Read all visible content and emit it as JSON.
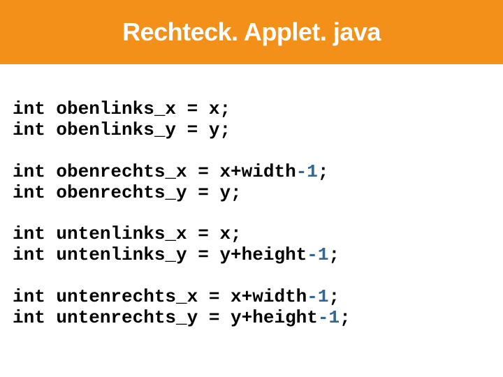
{
  "title": "Rechteck. Applet. java",
  "code": {
    "b1l1_a": "int obenlinks_x = x;",
    "b1l2_a": "int obenlinks_y = y;",
    "b2l1_a": "int obenrechts_x = x+width",
    "b2l1_b": "-1",
    "b2l1_c": ";",
    "b2l2_a": "int obenrechts_y = y;",
    "b3l1_a": "int untenlinks_x = x;",
    "b3l2_a": "int untenlinks_y = y+height",
    "b3l2_b": "-1",
    "b3l2_c": ";",
    "b4l1_a": "int untenrechts_x = x+width",
    "b4l1_b": "-1",
    "b4l1_c": ";",
    "b4l2_a": "int untenrechts_y = y+height",
    "b4l2_b": "-1",
    "b4l2_c": ";"
  }
}
